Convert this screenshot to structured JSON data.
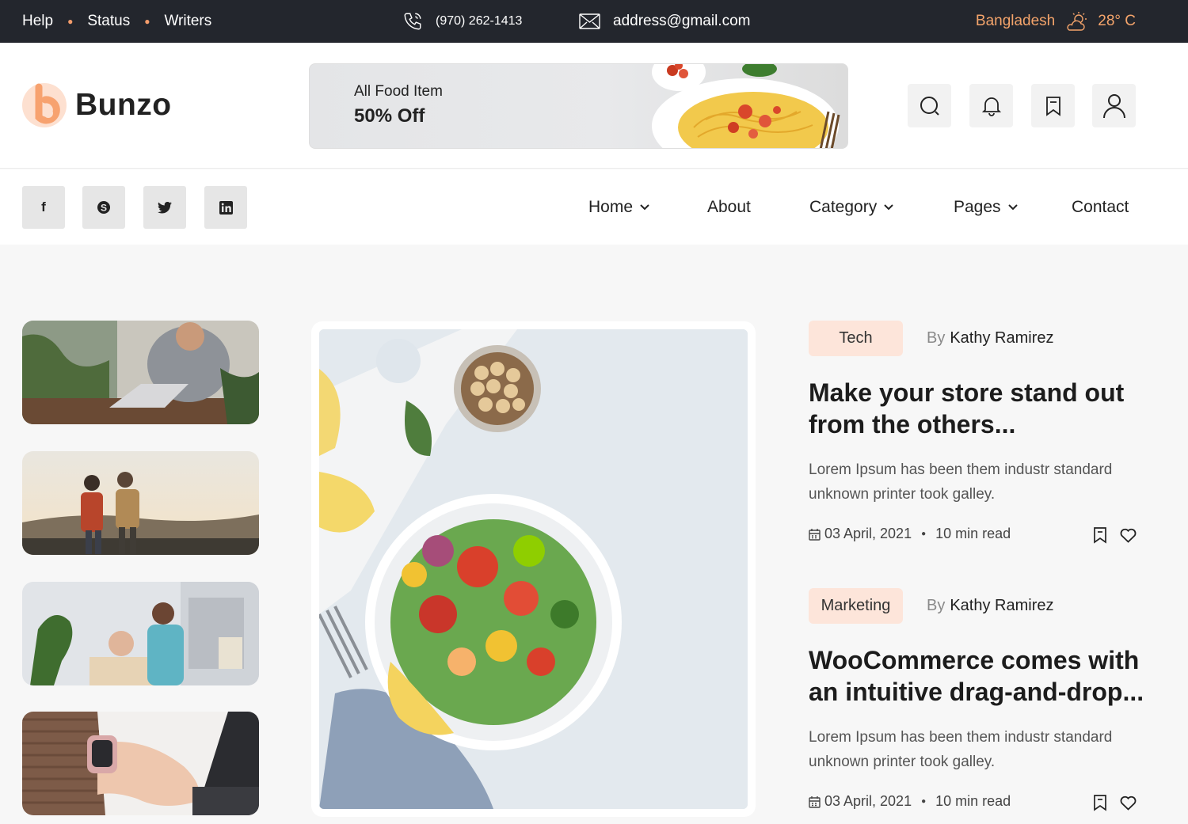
{
  "topbar": {
    "links": [
      "Help",
      "Status",
      "Writers"
    ],
    "phone": "(970) 262-1413",
    "email": "address@gmail.com",
    "location": "Bangladesh",
    "temperature": "28° C"
  },
  "header": {
    "logo_text": "Bunzo",
    "banner": {
      "line1": "All Food Item",
      "line2": "50% Off"
    },
    "icons": [
      "search-icon",
      "bell-icon",
      "bookmark-icon",
      "user-icon"
    ]
  },
  "social": [
    "f",
    "S",
    "twitter-icon",
    "in"
  ],
  "nav": [
    {
      "label": "Home",
      "dropdown": true
    },
    {
      "label": "About",
      "dropdown": false
    },
    {
      "label": "Category",
      "dropdown": true
    },
    {
      "label": "Pages",
      "dropdown": true
    },
    {
      "label": "Contact",
      "dropdown": false
    }
  ],
  "articles": [
    {
      "tag": "Tech",
      "by": "By",
      "author": "Kathy Ramirez",
      "title": "Make your store stand out from the others...",
      "excerpt": "Lorem Ipsum has been them industr standard unknown printer took galley.",
      "date": "03 April, 2021",
      "read": "10 min read"
    },
    {
      "tag": "Marketing",
      "by": "By",
      "author": "Kathy Ramirez",
      "title": "WooCommerce comes with an intuitive drag-and-drop...",
      "excerpt": "Lorem Ipsum has been them industr standard unknown printer took galley.",
      "date": "03 April, 2021",
      "read": "10 min read"
    }
  ],
  "colors": {
    "accent": "#f4a46b",
    "dark": "#23262d",
    "tag_bg": "#fde5da"
  }
}
